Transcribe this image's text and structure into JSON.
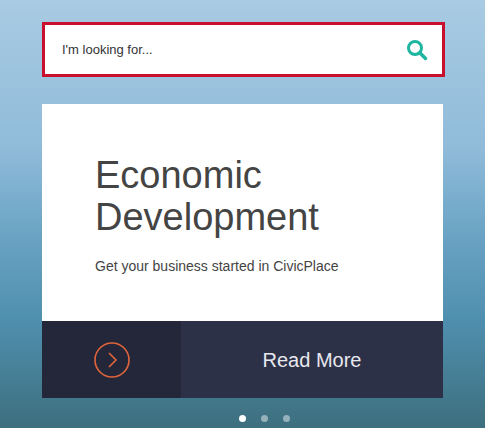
{
  "search": {
    "placeholder": "I'm looking for..."
  },
  "slide": {
    "title": "Economic Development",
    "subtitle": "Get your business started in CivicPlace",
    "button": "Read More"
  },
  "carousel": {
    "dots": [
      {
        "selected": true
      },
      {
        "selected": false
      },
      {
        "selected": false
      }
    ]
  }
}
